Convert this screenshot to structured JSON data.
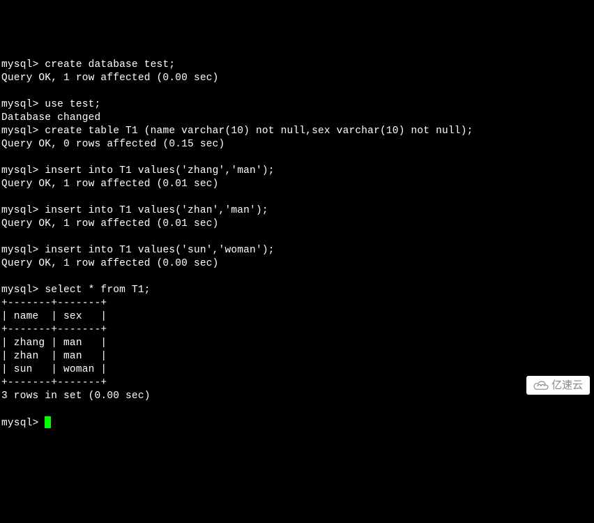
{
  "prompt": "mysql> ",
  "commands": {
    "create_db": "create database test;",
    "create_db_result": "Query OK, 1 row affected (0.00 sec)",
    "use_db": "use test;",
    "use_db_result": "Database changed",
    "create_table": "create table T1 (name varchar(10) not null,sex varchar(10) not null);",
    "create_table_result": "Query OK, 0 rows affected (0.15 sec)",
    "insert1": "insert into T1 values('zhang','man');",
    "insert1_result": "Query OK, 1 row affected (0.01 sec)",
    "insert2": "insert into T1 values('zhan','man');",
    "insert2_result": "Query OK, 1 row affected (0.01 sec)",
    "insert3": "insert into T1 values('sun','woman');",
    "insert3_result": "Query OK, 1 row affected (0.00 sec)",
    "select": "select * from T1;"
  },
  "table": {
    "border": "+-------+-------+",
    "header": "| name  | sex   |",
    "rows": [
      "| zhang | man   |",
      "| zhan  | man   |",
      "| sun   | woman |"
    ],
    "footer": "3 rows in set (0.00 sec)"
  },
  "watermark": {
    "text": "亿速云"
  }
}
